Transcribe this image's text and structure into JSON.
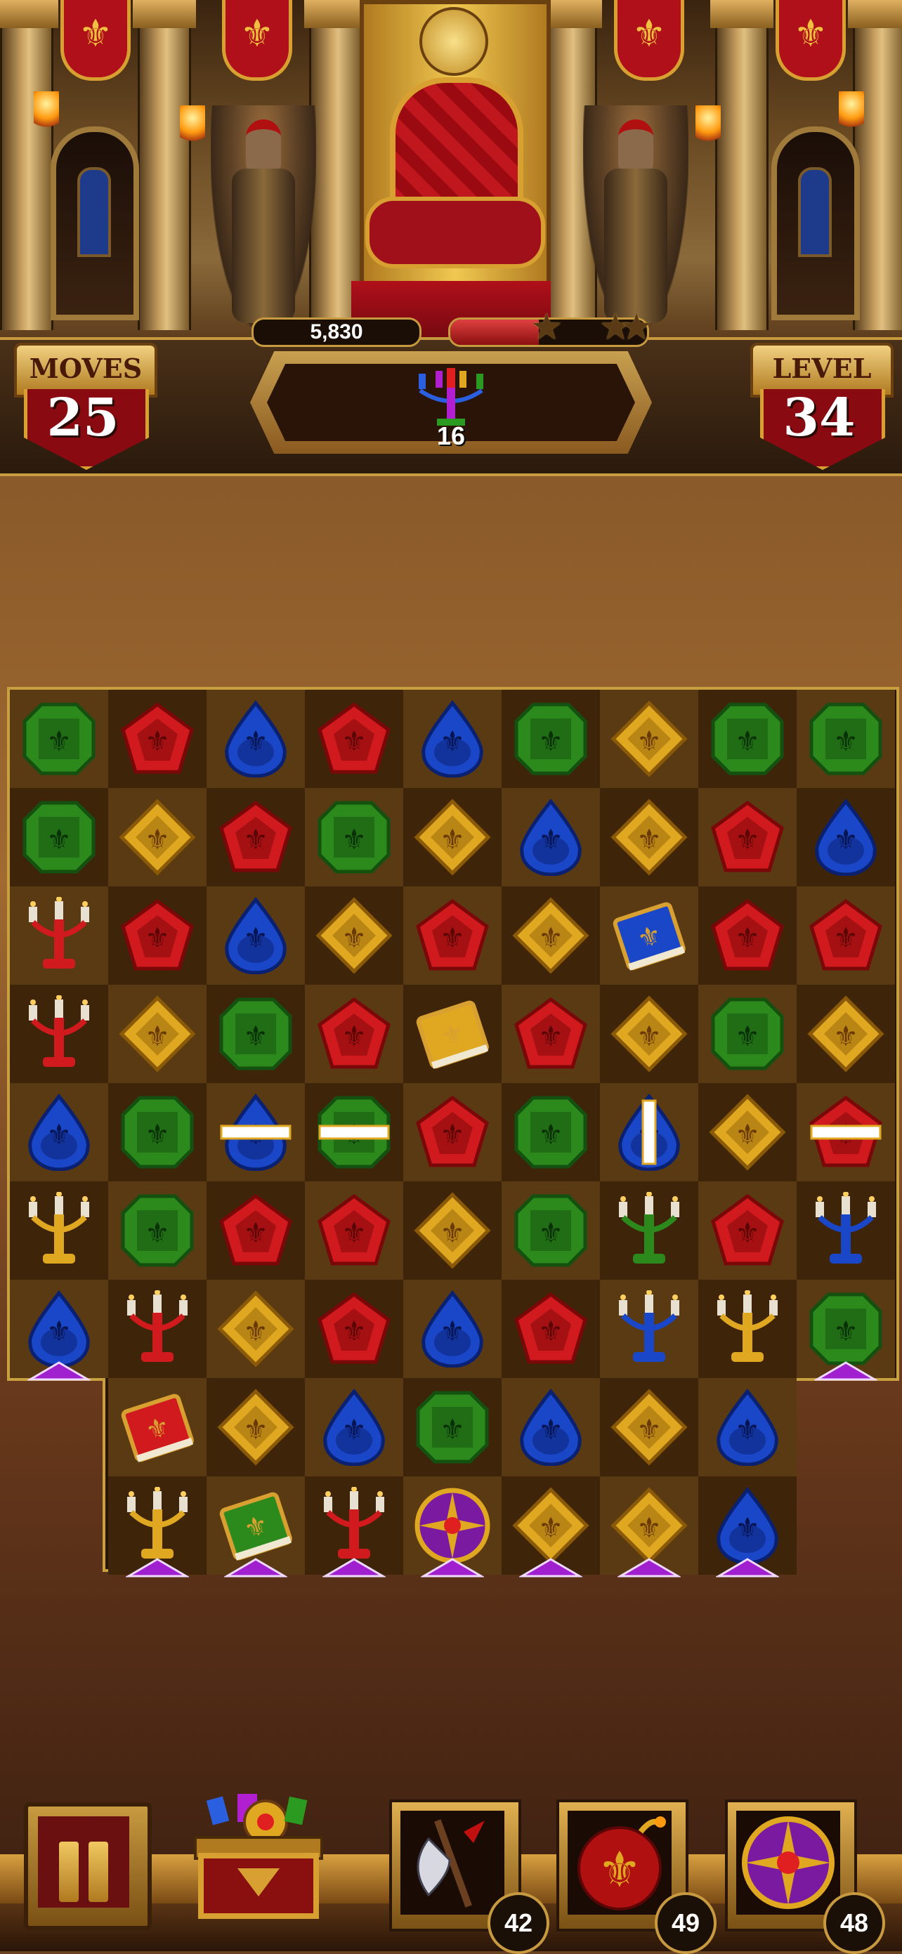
{
  "hud": {
    "score": "5,830",
    "score_progress": 0.45,
    "stars_earned": 0,
    "stars_total": 3,
    "moves_label": "MOVES",
    "moves_value": "25",
    "level_label": "LEVEL",
    "level_value": "34",
    "goal_item": "candelabra-multicolor",
    "goal_count": "16"
  },
  "board": {
    "columns": 9,
    "rows": 9,
    "grid": [
      [
        "green",
        "red",
        "blue",
        "red",
        "blue",
        "green",
        "gold",
        "green",
        "green"
      ],
      [
        "green",
        "gold",
        "red",
        "green",
        "gold",
        "blue",
        "gold",
        "red",
        "blue"
      ],
      [
        "candle-red",
        "red",
        "blue",
        "gold",
        "red",
        "gold",
        "book-blue",
        "red",
        "red"
      ],
      [
        "candle-red",
        "gold",
        "green",
        "red",
        "book-gold",
        "red",
        "gold",
        "green",
        "gold"
      ],
      [
        "blue",
        "green",
        "blue-striped-h",
        "green-striped-h",
        "red",
        "green",
        "blue-striped-v",
        "gold",
        "red-striped-h"
      ],
      [
        "candle-gold",
        "green",
        "red",
        "red",
        "gold",
        "green",
        "candle-green",
        "red",
        "candle-blue"
      ],
      [
        "blue",
        "candle-red",
        "gold",
        "red",
        "blue",
        "red",
        "candle-blue",
        "candle-gold",
        "green"
      ],
      [
        null,
        "book-red",
        "gold",
        "blue",
        "green",
        "blue",
        "gold",
        "blue",
        null
      ],
      [
        null,
        "candle-gold",
        "book-green",
        "candle-red",
        "compass-bomb",
        "gold",
        "gold",
        "blue",
        null
      ]
    ],
    "drop_arrow_columns_upper": [
      0,
      8
    ],
    "drop_arrow_columns_lower": [
      1,
      2,
      3,
      4,
      5,
      6,
      7
    ]
  },
  "toolbar": {
    "pause_icon": "pause-icon",
    "chest_icon": "treasure-chest-icon",
    "boosters": [
      {
        "icon": "battle-axe-icon",
        "count": "42"
      },
      {
        "icon": "fleur-de-lis-bomb-icon",
        "count": "49"
      },
      {
        "icon": "compass-rose-icon",
        "count": "48"
      }
    ]
  },
  "colors": {
    "red": "#d01a1e",
    "green": "#2c8a1c",
    "blue": "#1a46c8",
    "gold": "#e0a820",
    "accent_purple": "#a020d0"
  }
}
